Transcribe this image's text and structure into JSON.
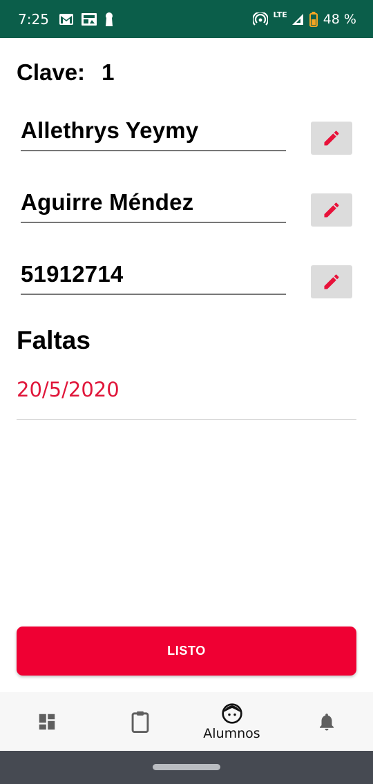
{
  "status_bar": {
    "time": "7:25",
    "network_label": "LTE",
    "battery_text": "48 %",
    "left_icons": [
      "gmail-icon",
      "news-icon",
      "keyhole-icon"
    ],
    "right_icons": [
      "hotspot-icon",
      "signal-icon",
      "battery-icon"
    ]
  },
  "student": {
    "clave_label": "Clave:",
    "clave_value": "1",
    "first_name": "Allethrys Yeymy",
    "last_name": "Aguirre Méndez",
    "phone": "51912714"
  },
  "absences": {
    "title": "Faltas",
    "items": [
      {
        "date": "20/5/2020"
      }
    ]
  },
  "actions": {
    "done_label": "LISTO"
  },
  "bottom_nav": {
    "items": [
      {
        "icon": "dashboard-icon",
        "label": ""
      },
      {
        "icon": "clipboard-icon",
        "label": ""
      },
      {
        "icon": "student-face-icon",
        "label": "Alumnos",
        "active": true
      },
      {
        "icon": "bell-icon",
        "label": ""
      }
    ]
  },
  "colors": {
    "status_bar": "#0b5e4a",
    "accent": "#ef0033",
    "date_text": "#e0163a",
    "edit_button_bg": "#dcdcdc",
    "system_nav": "#464a52"
  }
}
